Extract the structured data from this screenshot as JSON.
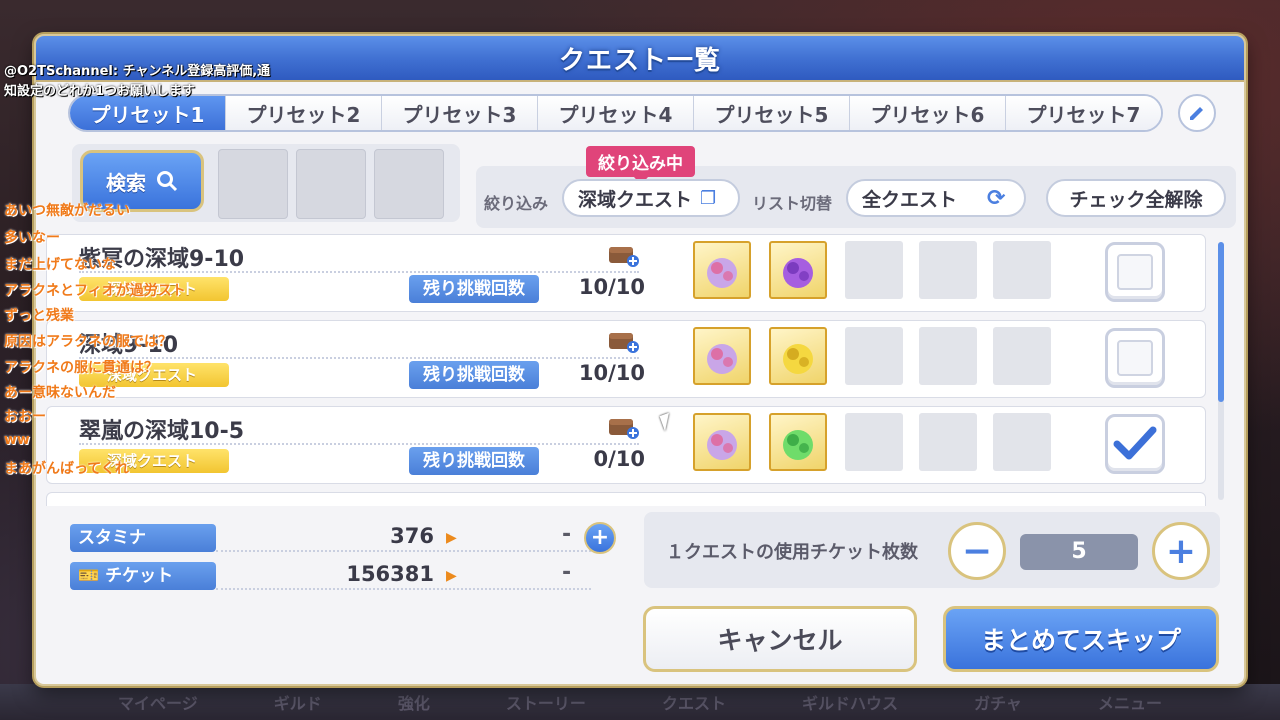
{
  "modal": {
    "title": "クエスト一覧"
  },
  "tabs": [
    {
      "label": "プリセット1",
      "active": true
    },
    {
      "label": "プリセット2",
      "active": false
    },
    {
      "label": "プリセット3",
      "active": false
    },
    {
      "label": "プリセット4",
      "active": false
    },
    {
      "label": "プリセット5",
      "active": false
    },
    {
      "label": "プリセット6",
      "active": false
    },
    {
      "label": "プリセット7",
      "active": false
    }
  ],
  "search": {
    "label": "検索"
  },
  "filter": {
    "badge": "絞り込み中",
    "filter_label": "絞り込み",
    "filter_value": "深域クエスト",
    "list_label": "リスト切替",
    "list_value": "全クエスト",
    "uncheck_all": "チェック全解除"
  },
  "quests": [
    {
      "name": "紫冥の深域9-10",
      "type": "深域クエスト",
      "attempts_label": "残り挑戦回数",
      "attempts": "10/10",
      "checked": false,
      "rewards": [
        "feather-crest-icon",
        "purple-orb-icon"
      ]
    },
    {
      "name": "深域9-10",
      "type": "深域クエスト",
      "attempts_label": "残り挑戦回数",
      "attempts": "10/10",
      "checked": false,
      "rewards": [
        "feather-crest-icon",
        "yellow-orb-icon"
      ]
    },
    {
      "name": "翠嵐の深域10-5",
      "type": "深域クエスト",
      "attempts_label": "残り挑戦回数",
      "attempts": "0/10",
      "checked": true,
      "rewards": [
        "feather-crest-icon",
        "green-orb-icon"
      ]
    }
  ],
  "resources": {
    "stamina_label": "スタミナ",
    "stamina": "376",
    "stamina_after": "-",
    "ticket_label": "チケット",
    "ticket": "156381",
    "ticket_after": "-"
  },
  "ticket_panel": {
    "label": "１クエストの使用チケット枚数",
    "count": "5"
  },
  "buttons": {
    "cancel": "キャンセル",
    "skip": "まとめてスキップ"
  },
  "background_nav": [
    "マイページ",
    "ギルド",
    "強化",
    "ストーリー",
    "クエスト",
    "ギルドハウス",
    "ガチャ",
    "メニュー"
  ],
  "overlay": {
    "channel_handle": "@O2TSchannel:",
    "channel_text": "チャンネル登録高評価,通",
    "line2": "知設定のどれか1つお願いします",
    "comments": [
      "あいつ無敵がだるい",
      "多いなー",
      "まだ上げてないな",
      "アラクネとフィオが過労スト",
      "ずっと残業",
      "原因はアラクネの服では？",
      "アラクネの服に貫通は？",
      "あー意味ないんだ",
      "おおー",
      "ww",
      "まあがんばってくれ"
    ]
  },
  "colors": {
    "accent": "#3c70d8",
    "badge": "#e0447a",
    "gold": "#d9c37e",
    "comment": "#f07a1a"
  }
}
